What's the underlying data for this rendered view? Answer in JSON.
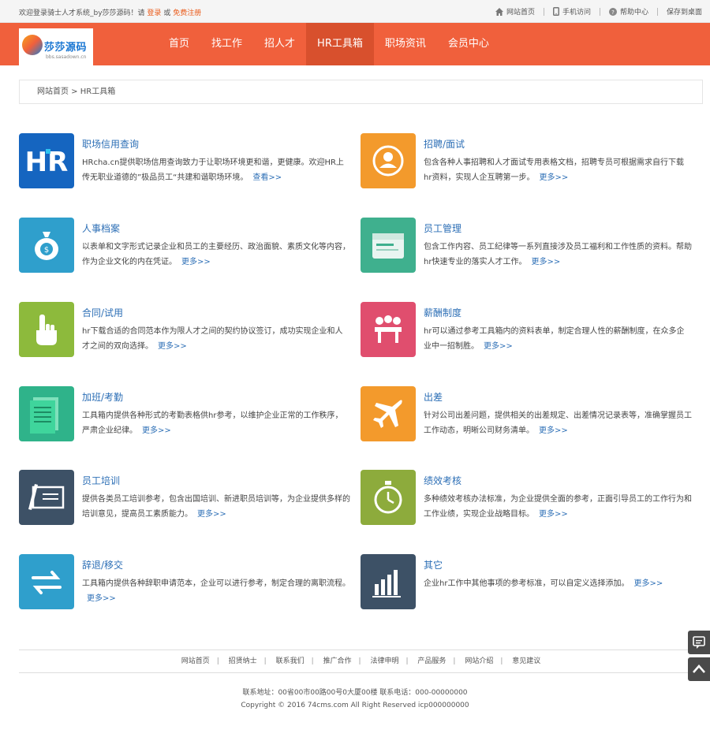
{
  "topbar": {
    "welcome_prefix": "欢迎登录骑士人才系统_by莎莎源码！请",
    "login": "登录",
    "or": "或",
    "register": "免费注册",
    "links": [
      "网站首页",
      "手机访问",
      "帮助中心",
      "保存到桌面"
    ]
  },
  "logo": {
    "text": "莎莎源码",
    "sub": "bbs.sasadown.cn"
  },
  "nav": [
    "首页",
    "找工作",
    "招人才",
    "HR工具箱",
    "职场资讯",
    "会员中心"
  ],
  "nav_active": "HR工具箱",
  "breadcrumb": "网站首页 > HR工具箱",
  "cards": [
    {
      "title": "职场信用查询",
      "desc": "HRcha.cn提供职场信用查询致力于让职场环境更和谐，更健康。欢迎HR上传无职业道德的”极品员工“共建和谐职场环境。",
      "more": "查看>>",
      "icon": "hr-logo-icon",
      "color": "#1565c0"
    },
    {
      "title": "招聘/面试",
      "desc": "包含各种人事招聘和人才面试专用表格文档，招聘专员可根据需求自行下载hr资料，实现人企互聘第一步。",
      "more": "更多>>",
      "icon": "person-badge-icon",
      "color": "#f39a2c"
    },
    {
      "title": "人事档案",
      "desc": "以表单和文字形式记录企业和员工的主要经历、政治面貌、素质文化等内容，作为企业文化的内在凭证。",
      "more": "更多>>",
      "icon": "money-bag-icon",
      "color": "#2f9fcc"
    },
    {
      "title": "员工管理",
      "desc": "包含工作内容、员工纪律等一系列直接涉及员工福利和工作性质的资料。帮助hr快速专业的落实人才工作。",
      "more": "更多>>",
      "icon": "resume-file-icon",
      "color": "#3fb08e"
    },
    {
      "title": "合同/试用",
      "desc": "hr下载合适的合同范本作为限人才之间的契约协议签订，成功实现企业和人才之间的双向选择。",
      "more": "更多>>",
      "icon": "hand-pointer-icon",
      "color": "#8dba3c"
    },
    {
      "title": "薪酬制度",
      "desc": "hr可以通过参考工具箱内的资料表单，制定合理人性的薪酬制度，在众多企业中一招制胜。",
      "more": "更多>>",
      "icon": "team-meeting-icon",
      "color": "#e04e6e"
    },
    {
      "title": "加班/考勤",
      "desc": "工具箱内提供各种形式的考勤表格供hr参考，以维护企业正常的工作秩序，严肃企业纪律。",
      "more": "更多>>",
      "icon": "attendance-sheet-icon",
      "color": "#2fb38a"
    },
    {
      "title": "出差",
      "desc": "针对公司出差问题，提供相关的出差规定、出差情况记录表等，准确掌握员工工作动态，明晰公司财务清单。",
      "more": "更多>>",
      "icon": "airplane-icon",
      "color": "#f39a2c"
    },
    {
      "title": "员工培训",
      "desc": "提供各类员工培训参考，包含出国培训、新进职员培训等，为企业提供多样的培训意见，提高员工素质能力。",
      "more": "更多>>",
      "icon": "pen-board-icon",
      "color": "#3d5166"
    },
    {
      "title": "绩效考核",
      "desc": "多种绩效考核办法标准，为企业提供全面的参考，正面引导员工的工作行为和工作业绩，实现企业战略目标。",
      "more": "更多>>",
      "icon": "stopwatch-icon",
      "color": "#8dab3c"
    },
    {
      "title": "辞退/移交",
      "desc": "工具箱内提供各种辞职申请范本，企业可以进行参考，制定合理的离职流程。",
      "more": "更多>>",
      "icon": "swap-arrows-icon",
      "color": "#2f9fcc"
    },
    {
      "title": "其它",
      "desc": "企业hr工作中其他事项的参考标准，可以自定义选择添加。",
      "more": "更多>>",
      "icon": "bar-chart-icon",
      "color": "#3d5166"
    }
  ],
  "footer": {
    "links": [
      "网站首页",
      "招贤纳士",
      "联系我们",
      "推广合作",
      "法律申明",
      "产品服务",
      "网站介绍",
      "意见建议"
    ],
    "address": "联系地址：00省00市00路00号0大厦00楼 联系电话：000-00000000",
    "copyright": "Copyright © 2016 74cms.com All Right Reserved icp000000000"
  }
}
